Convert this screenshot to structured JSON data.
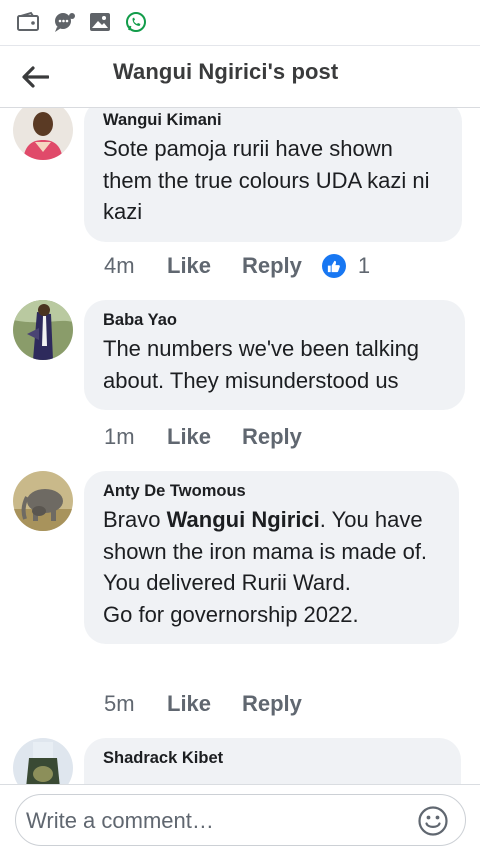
{
  "statusbar": {
    "icons": [
      "wallet-icon",
      "chat-bubble-icon",
      "gallery-icon",
      "whatsapp-icon"
    ]
  },
  "header": {
    "title": "Wangui Ngirici's post",
    "back_icon": "arrow-left-icon"
  },
  "comments": [
    {
      "author": "Wangui Kimani",
      "text": "Sote pamoja  rurii have shown them the true  colours UDA kazi ni kazi",
      "time": "4m",
      "like_label": "Like",
      "reply_label": "Reply",
      "reaction_icon": "thumbs-up-icon",
      "reaction_count": "1"
    },
    {
      "author": "Baba Yao",
      "text": "The numbers we've been talking about. They misunderstood us",
      "time": "1m",
      "like_label": "Like",
      "reply_label": "Reply"
    },
    {
      "author": "Anty De Twomous",
      "text_prefix": "Bravo ",
      "mention": "Wangui Ngirici",
      "text_suffix": ". You have shown the iron mama is made of.",
      "line2": "You delivered Rurii Ward.",
      "line3": "Go for governorship 2022.",
      "time": "5m",
      "like_label": "Like",
      "reply_label": "Reply"
    },
    {
      "author": "Shadrack Kibet"
    }
  ],
  "composer": {
    "placeholder": "Write a comment…",
    "emoji_icon": "smiley-icon"
  },
  "colors": {
    "bubble": "#f0f2f5",
    "like_blue": "#1877f2",
    "whatsapp_green": "#25d366",
    "muted_text": "#606770"
  }
}
